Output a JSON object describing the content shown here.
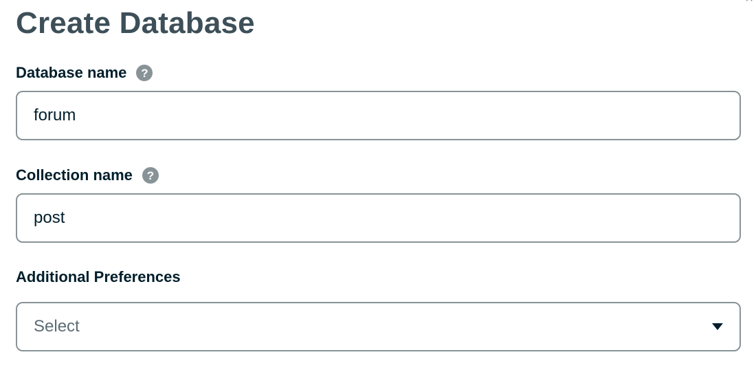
{
  "page": {
    "title": "Create Database"
  },
  "fields": {
    "database_name": {
      "label": "Database name",
      "value": "forum",
      "help_icon": "question-circle-icon"
    },
    "collection_name": {
      "label": "Collection name",
      "value": "post",
      "help_icon": "question-circle-icon"
    },
    "additional_preferences": {
      "label": "Additional Preferences",
      "selected": "Select",
      "caret_icon": "caret-down-icon"
    }
  },
  "close_icon": "close-icon",
  "colors": {
    "title": "#3d4f58",
    "label": "#001e2b",
    "border": "#889397",
    "help_icon_bg": "#889397"
  }
}
